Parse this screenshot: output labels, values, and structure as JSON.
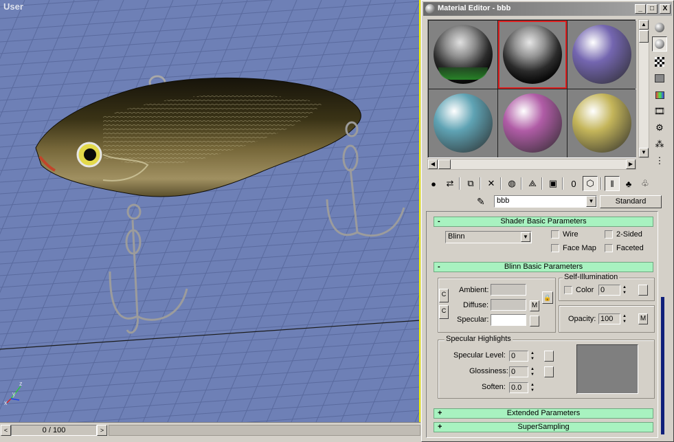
{
  "viewport": {
    "label": "User",
    "background": "#6e80b6",
    "axis": {
      "z": "z",
      "x": "x",
      "y": "y"
    }
  },
  "timeline": {
    "frame_display": "0 / 100",
    "prev": "<",
    "next": ">"
  },
  "editor": {
    "title": "Material Editor - bbb",
    "window_buttons": {
      "minimize": "_",
      "maximize": "□",
      "close": "X"
    },
    "slots": [
      {
        "name": "slot-1",
        "type": "textured",
        "active": false
      },
      {
        "name": "slot-2",
        "type": "textured",
        "active": true
      },
      {
        "name": "slot-3",
        "color": "#7466b0",
        "active": false
      },
      {
        "name": "slot-4",
        "color": "#5fa3b4",
        "active": false
      },
      {
        "name": "slot-5",
        "color": "#b05ca6",
        "active": false
      },
      {
        "name": "slot-6",
        "color": "#c4b55a",
        "active": false
      }
    ],
    "side_icons": [
      "sample-sphere-icon",
      "backlight-icon",
      "checker-background-icon",
      "sample-uv-icon",
      "video-color-check-icon",
      "make-preview-icon",
      "options-icon",
      "select-by-material-icon",
      "material-navigator-icon"
    ],
    "toolbar_icons": [
      "get-material-icon",
      "put-to-scene-icon",
      "assign-to-selection-icon",
      "reset-map-icon",
      "make-copy-icon",
      "make-unique-icon",
      "put-to-library-icon",
      "material-effects-channel-icon",
      "show-map-in-viewport-icon",
      "show-end-result-icon",
      "go-to-parent-icon",
      "go-forward-to-sibling-icon"
    ],
    "material_name": "bbb",
    "material_type": "Standard",
    "rollouts": {
      "shader": {
        "title": "Shader Basic Parameters",
        "toggle": "-",
        "shader_type": "Blinn",
        "wire": "Wire",
        "two_sided": "2-Sided",
        "face_map": "Face Map",
        "faceted": "Faceted"
      },
      "blinn": {
        "title": "Blinn Basic Parameters",
        "toggle": "-",
        "ambient": "Ambient:",
        "diffuse": "Diffuse:",
        "specular": "Specular:",
        "self_illum_title": "Self-Illumination",
        "color": "Color",
        "color_value": "0",
        "opacity": "Opacity:",
        "opacity_value": "100",
        "map_btn": "M",
        "lock": "🔒",
        "specular_highlights": "Specular Highlights",
        "spec_level": "Specular Level:",
        "spec_level_value": "0",
        "glossiness": "Glossiness:",
        "glossiness_value": "0",
        "soften": "Soften:",
        "soften_value": "0.0",
        "colors": {
          "ambient": "#c9c6c0",
          "diffuse": "#c9c6c0",
          "specular": "#ffffff"
        }
      },
      "extended": {
        "title": "Extended Parameters",
        "toggle": "+"
      },
      "supersampling": {
        "title": "SuperSampling",
        "toggle": "+"
      }
    }
  }
}
